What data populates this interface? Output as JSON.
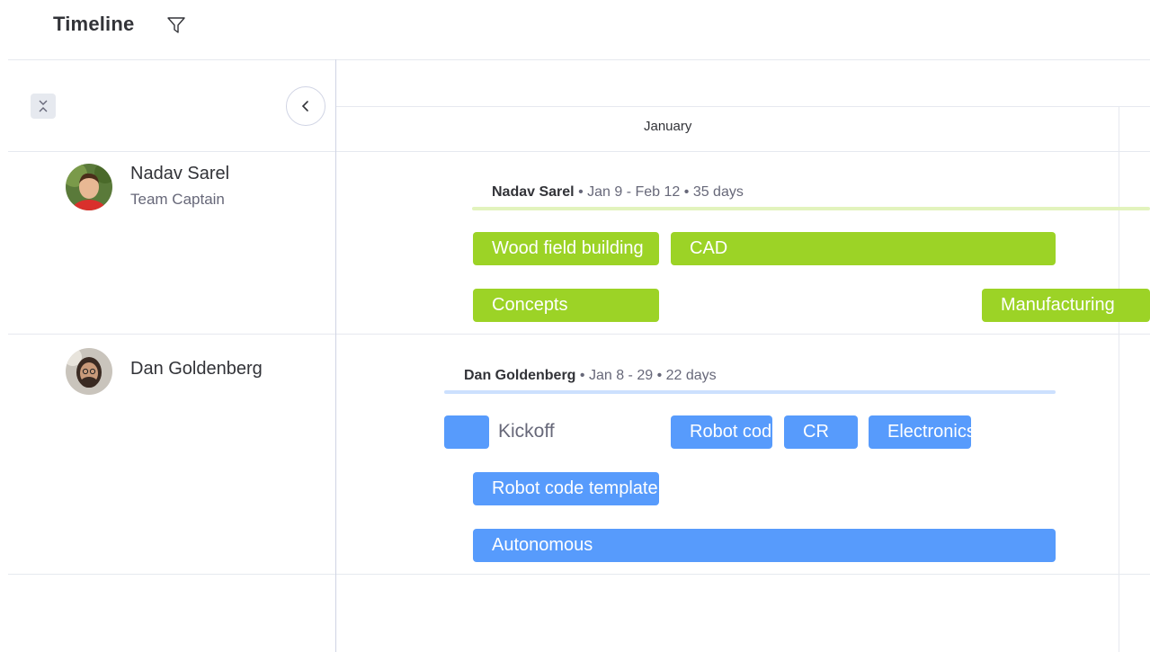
{
  "header": {
    "title": "Timeline",
    "filter_icon": "filter-icon"
  },
  "controls": {
    "collapse_all_icon": "collapse-all-icon",
    "collapse_panel_icon": "chevron-left-icon"
  },
  "timeline": {
    "month": "January"
  },
  "groups": [
    {
      "person": "Nadav Sarel",
      "role": "Team Captain",
      "summary_name": "Nadav Sarel",
      "summary_dates": "Jan 9 - Feb 12",
      "summary_duration": "35 days",
      "color": "#9cd326",
      "line_color": "#e2f3bd",
      "tasks": [
        "Wood field building",
        "CAD",
        "Concepts",
        "Manufacturing"
      ]
    },
    {
      "person": "Dan Goldenberg",
      "role": "",
      "summary_name": "Dan Goldenberg",
      "summary_dates": "Jan 8 - 29",
      "summary_duration": "22 days",
      "color": "#579bfc",
      "line_color": "#cce0fe",
      "milestone": "Kickoff",
      "tasks": [
        "Robot code",
        "CR",
        "Electronics",
        "Robot code template",
        "Autonomous"
      ]
    }
  ]
}
